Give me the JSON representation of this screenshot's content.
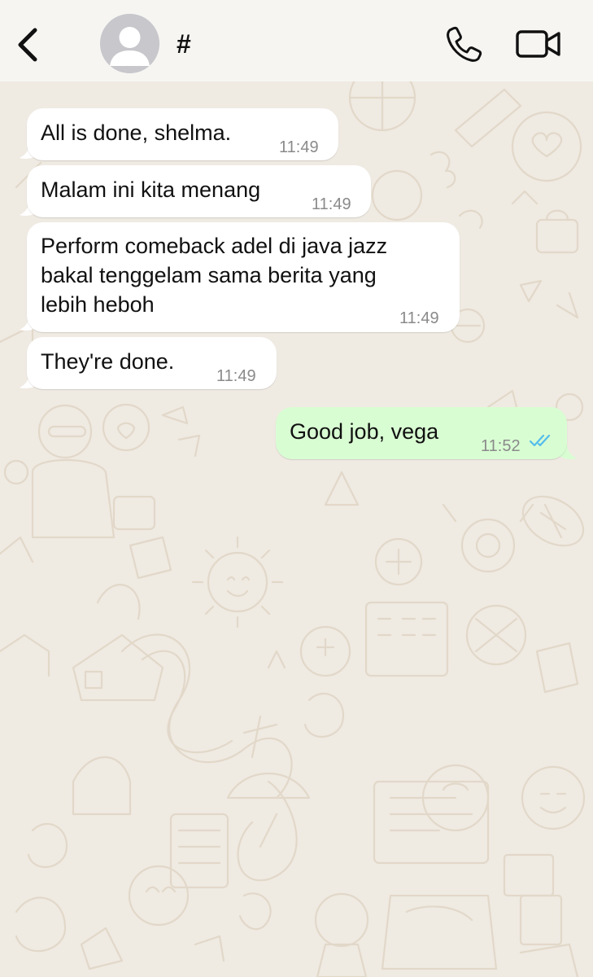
{
  "header": {
    "contact_name": "#",
    "back_icon": "chevron-left-icon",
    "avatar_icon": "default-avatar-icon",
    "call_icon": "phone-icon",
    "video_icon": "video-camera-icon"
  },
  "messages": [
    {
      "direction": "incoming",
      "lines": [
        "All is done, shelma."
      ],
      "time": "11:49"
    },
    {
      "direction": "incoming",
      "lines": [
        "Malam ini kita menang"
      ],
      "time": "11:49"
    },
    {
      "direction": "incoming",
      "lines": [
        "Perform comeback adel di java jazz",
        "bakal tenggelam sama berita yang",
        "lebih heboh"
      ],
      "time": "11:49"
    },
    {
      "direction": "incoming",
      "lines": [
        "They're done."
      ],
      "time": "11:49"
    },
    {
      "direction": "outgoing",
      "lines": [
        "Good job, vega"
      ],
      "time": "11:52",
      "status": "read",
      "status_icon": "double-check-icon"
    }
  ],
  "colors": {
    "chat_background": "#efeae2",
    "incoming_bubble": "#ffffff",
    "outgoing_bubble": "#d9fdd3",
    "read_ticks": "#53bdeb"
  }
}
